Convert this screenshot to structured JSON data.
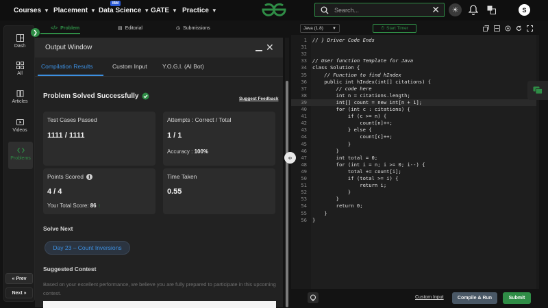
{
  "nav": {
    "items": [
      {
        "label": "Courses"
      },
      {
        "label": "Placement"
      },
      {
        "label": "Data Science"
      },
      {
        "label": "GATE"
      },
      {
        "label": "Practice"
      }
    ],
    "ibm_badge": "IBM",
    "search_placeholder": "Search...",
    "avatar_letter": "S",
    "brand_color": "#2f8d46"
  },
  "rail": {
    "items": [
      {
        "label": "Dash",
        "icon": "dash-icon"
      },
      {
        "label": "All",
        "icon": "grid-icon"
      },
      {
        "label": "Articles",
        "icon": "book-icon"
      },
      {
        "label": "Videos",
        "icon": "video-icon"
      },
      {
        "label": "Problems",
        "icon": "code-icon"
      }
    ],
    "prev_label": "« Prev",
    "next_label": "Next »"
  },
  "problem_tabs": [
    {
      "label": "Problem",
      "icon": "</>"
    },
    {
      "label": "Editorial",
      "icon": "▤"
    },
    {
      "label": "Submissions",
      "icon": "◷"
    }
  ],
  "output": {
    "title": "Output Window",
    "tabs": [
      "Compilation Results",
      "Custom Input",
      "Y.O.G.I. (AI Bot)"
    ],
    "status": "Problem Solved Successfully",
    "feedback": "Suggest Feedback",
    "cards": {
      "tests_label": "Test Cases Passed",
      "tests_value": "1111 / 1111",
      "attempts_label": "Attempts : Correct / Total",
      "attempts_value": "1 / 1",
      "accuracy_label": "Accuracy :",
      "accuracy_value": "100%",
      "points_label": "Points Scored",
      "points_value": "4 / 4",
      "total_score_label": "Your Total Score:",
      "total_score_value": "86",
      "time_label": "Time Taken",
      "time_value": "0.55"
    },
    "solve_next": "Solve Next",
    "next_problem": "Day 23 – Count Inversions",
    "suggested_contest": "Suggested Contest",
    "suggested_text": "Based on your excellent performance, we believe you are fully prepared to participate in this upcoming contest."
  },
  "editor": {
    "language": "Java (1.8)",
    "timer_label": "Start Timer",
    "lines": [
      {
        "n": "1",
        "t": "// } Driver Code Ends",
        "c": "cm"
      },
      {
        "n": "31",
        "t": "",
        "c": ""
      },
      {
        "n": "32",
        "t": "",
        "c": ""
      },
      {
        "n": "33",
        "t": "// User function Template for Java",
        "c": "cm"
      },
      {
        "n": "34",
        "t": "class Solution {",
        "c": ""
      },
      {
        "n": "35",
        "t": "    // Function to find hIndex",
        "c": "cm"
      },
      {
        "n": "36",
        "t": "    public int hIndex(int[] citations) {",
        "c": ""
      },
      {
        "n": "37",
        "t": "        // code here",
        "c": "cm"
      },
      {
        "n": "38",
        "t": "        int n = citations.length;",
        "c": ""
      },
      {
        "n": "39",
        "t": "        int[] count = new int[n + 1];",
        "c": "hl"
      },
      {
        "n": "40",
        "t": "        for (int c : citations) {",
        "c": ""
      },
      {
        "n": "41",
        "t": "            if (c >= n) {",
        "c": ""
      },
      {
        "n": "42",
        "t": "                count[n]++;",
        "c": ""
      },
      {
        "n": "43",
        "t": "            } else {",
        "c": ""
      },
      {
        "n": "44",
        "t": "                count[c]++;",
        "c": ""
      },
      {
        "n": "45",
        "t": "            }",
        "c": ""
      },
      {
        "n": "46",
        "t": "        }",
        "c": ""
      },
      {
        "n": "47",
        "t": "        int total = 0;",
        "c": ""
      },
      {
        "n": "48",
        "t": "        for (int i = n; i >= 0; i--) {",
        "c": ""
      },
      {
        "n": "49",
        "t": "            total += count[i];",
        "c": ""
      },
      {
        "n": "50",
        "t": "            if (total >= i) {",
        "c": ""
      },
      {
        "n": "51",
        "t": "                return i;",
        "c": ""
      },
      {
        "n": "52",
        "t": "            }",
        "c": ""
      },
      {
        "n": "53",
        "t": "        }",
        "c": ""
      },
      {
        "n": "54",
        "t": "        return 0;",
        "c": ""
      },
      {
        "n": "55",
        "t": "    }",
        "c": ""
      },
      {
        "n": "56",
        "t": "}",
        "c": ""
      }
    ],
    "custom_input": "Custom Input",
    "compile_label": "Compile & Run",
    "submit_label": "Submit"
  }
}
